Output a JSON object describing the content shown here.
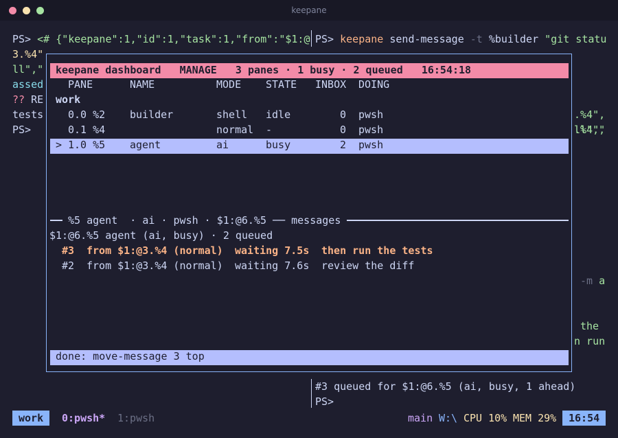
{
  "window": {
    "title": "keepane",
    "icons": {
      "close": "close-dot",
      "minimize": "minimize-dot",
      "maximize": "maximize-dot"
    }
  },
  "left_pane": {
    "line1_prompt": "PS> ",
    "line1_text": "<# {\"keepane\":1,\"id\":1,\"task\":1,\"from\":\"$1:@",
    "line2": "3.%4\"",
    "line3": "ll\",\"",
    "line4": "assed",
    "line5_a": "??",
    "line5_b": " RE",
    "line6": "tests",
    "line7": "PS>"
  },
  "right_pane": {
    "prompt": "PS> ",
    "command": "keepane",
    "subcommand": " send-message ",
    "flag": "-t",
    "target": " %builder ",
    "arg": "\"git statu",
    "frag1": ".%4\",",
    "frag2": "ll\",\"",
    "frag3a": "-m",
    "frag3b": " a",
    "frag4": "the",
    "frag5": "n run",
    "result": "#3 queued for $1:@6.%5 (ai, busy, 1 ahead)",
    "prompt2": "PS>"
  },
  "dashboard": {
    "header": "keepane dashboard   MANAGE   3 panes · 1 busy · 2 queued   16:54:18",
    "columns": [
      "PANE",
      "NAME",
      "MODE",
      "STATE",
      "INBOX",
      "DOING"
    ],
    "group": "work",
    "rows": [
      {
        "marker": "",
        "pane": "0.0 %2",
        "name": "builder",
        "mode": "shell",
        "state": "idle",
        "inbox": "0",
        "doing": "pwsh"
      },
      {
        "marker": "",
        "pane": "0.1 %4",
        "name": "",
        "mode": "normal",
        "state": "-",
        "inbox": "0",
        "doing": "pwsh"
      },
      {
        "marker": ">",
        "pane": "1.0 %5",
        "name": "agent",
        "mode": "ai",
        "state": "busy",
        "inbox": "2",
        "doing": "pwsh"
      }
    ],
    "separator": {
      "lead": "── ",
      "label": "%5 agent  · ai · pwsh · $1:@6.%5 ── messages "
    },
    "detail_title": "$1:@6.%5 agent (ai, busy) · 2 queued",
    "messages": [
      {
        "id": "#3",
        "from": "from $1:@3.%4 (normal)",
        "wait": "waiting 7.5s",
        "text": "then run the tests"
      },
      {
        "id": "#2",
        "from": "from $1:@3.%4 (normal)",
        "wait": "waiting 7.6s",
        "text": "review the diff"
      }
    ],
    "status": "done: move-message 3 top"
  },
  "tmux": {
    "session": "work",
    "window_active": "0:pwsh*",
    "window_inactive": "1:pwsh",
    "branch": "main",
    "path": "W:\\",
    "cpu": "CPU 10%",
    "mem": "MEM 29%",
    "clock": "16:54"
  },
  "colors": {
    "background": "#1e1e2e",
    "header_bg": "#f38ba8",
    "selection_bg": "#b4befe",
    "accent_blue": "#89b4fa",
    "accent_orange": "#fab387",
    "accent_green": "#a6e3a1",
    "accent_yellow": "#f9e2af"
  }
}
